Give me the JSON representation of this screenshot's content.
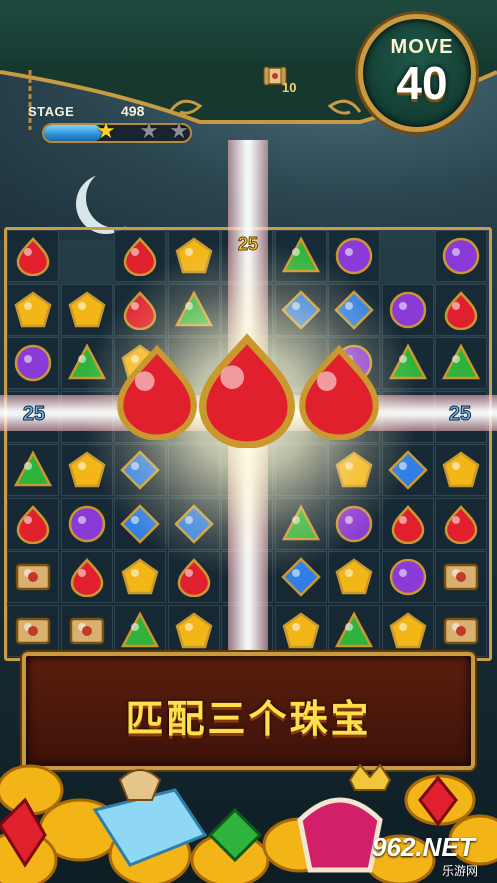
{
  "hud": {
    "stage_label": "STAGE",
    "stage_number": "498",
    "stars_earned": 1,
    "stars_total": 3,
    "progress_fraction": 0.4,
    "move_label": "MOVE",
    "move_value": "40",
    "scroll_goal_count": "10",
    "scroll_icon": "scroll-icon"
  },
  "board": {
    "columns": 9,
    "rows": 8,
    "gem_types": {
      "R": {
        "name": "red-drop-gem",
        "color": "#e0202c"
      },
      "Y": {
        "name": "yellow-pentagon-gem",
        "color": "#f2b617"
      },
      "G": {
        "name": "green-triangle-gem",
        "color": "#2fb33c"
      },
      "P": {
        "name": "purple-round-gem",
        "color": "#8a3ad6"
      },
      "B": {
        "name": "blue-diamond-gem",
        "color": "#2f7fe6"
      },
      "S": {
        "name": "scroll-tile",
        "color": "#d9b070"
      }
    },
    "grid": [
      [
        "R",
        null,
        "R",
        "Y",
        "",
        "G",
        "P",
        null,
        "P"
      ],
      [
        "Y",
        "Y",
        "R",
        "G",
        "",
        "B",
        "B",
        "P",
        "R"
      ],
      [
        "P",
        "G",
        "Y",
        "",
        "",
        "",
        "P",
        "G",
        "G"
      ],
      [
        "",
        "",
        "",
        "",
        "",
        "",
        "",
        "",
        ""
      ],
      [
        "G",
        "Y",
        "B",
        "",
        "",
        "",
        "Y",
        "B",
        "Y"
      ],
      [
        "R",
        "P",
        "B",
        "B",
        "",
        "G",
        "P",
        "R",
        "R"
      ],
      [
        "S",
        "R",
        "Y",
        "R",
        "",
        "B",
        "Y",
        "P",
        "S"
      ],
      [
        "S",
        "S",
        "G",
        "Y",
        "",
        "Y",
        "G",
        "Y",
        "S"
      ]
    ],
    "holes": [
      [
        0,
        1
      ],
      [
        0,
        7
      ]
    ]
  },
  "combo": {
    "big_gem_type": "red-drop-gem",
    "big_gem_count": 3,
    "floating_score_left": "25",
    "floating_score_right": "25",
    "floating_score_top": "25"
  },
  "tagline": "匹配三个珠宝",
  "watermark": {
    "brand": "962.NET",
    "sub": "乐游网"
  },
  "colors": {
    "banner": "#1f4a3f",
    "gold_frame": "#c89a42",
    "panel": "#5a1e0e",
    "tagline": "#ffe04a"
  }
}
